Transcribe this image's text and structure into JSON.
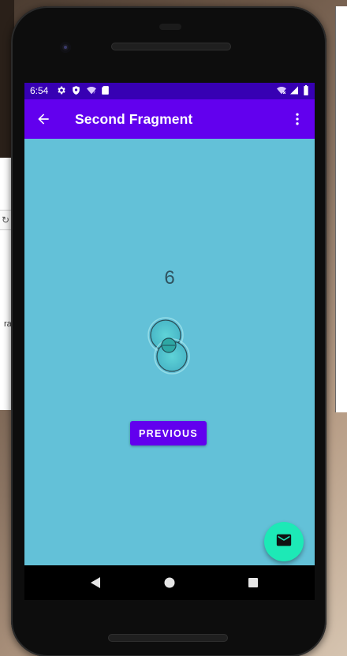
{
  "status_bar": {
    "time": "6:54",
    "icons_left": [
      "settings-icon",
      "shield-icon",
      "wifi-question-icon",
      "sd-card-icon"
    ],
    "icons_right": [
      "wifi-x-icon",
      "signal-icon",
      "battery-icon"
    ],
    "color": "#3700b3"
  },
  "app_bar": {
    "title": "Second Fragment",
    "back_icon": "arrow-left-icon",
    "menu_icon": "more-vert-icon",
    "color": "#6200ee"
  },
  "content": {
    "count": "6",
    "background": "#63c1d8",
    "previous_label": "PREVIOUS"
  },
  "fab": {
    "icon": "mail-icon",
    "color": "#1de9b6"
  },
  "nav_bar": {
    "icons": [
      "back-triangle-icon",
      "home-circle-icon",
      "recents-square-icon"
    ]
  },
  "background": {
    "left_fragment_text": "ra"
  }
}
